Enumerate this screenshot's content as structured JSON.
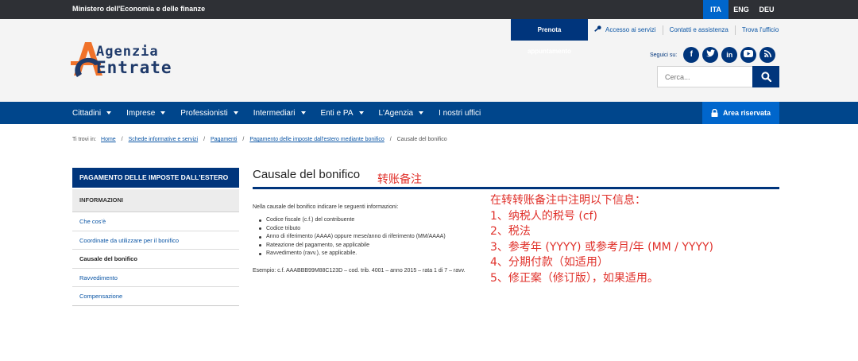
{
  "topbar": {
    "ministry": "Ministero dell'Economia e delle finanze",
    "languages": [
      {
        "label": "ITA",
        "active": true
      },
      {
        "label": "ENG",
        "active": false
      },
      {
        "label": "DEU",
        "active": false
      }
    ]
  },
  "header": {
    "logo": {
      "line1": "Agenzia",
      "line2": "Entrate"
    },
    "links": {
      "prenota": "Prenota appuntamento",
      "accesso": "Accesso ai servizi",
      "contatti": "Contatti e assistenza",
      "ufficio": "Trova l'ufficio"
    },
    "social_label": "Seguici su:",
    "social_icons": [
      "facebook-icon",
      "twitter-icon",
      "linkedin-icon",
      "youtube-icon",
      "rss-icon"
    ],
    "search": {
      "placeholder": "Cerca..."
    }
  },
  "nav": {
    "items": [
      {
        "label": "Cittadini"
      },
      {
        "label": "Imprese"
      },
      {
        "label": "Professionisti"
      },
      {
        "label": "Intermediari"
      },
      {
        "label": "Enti e PA"
      },
      {
        "label": "L'Agenzia"
      },
      {
        "label": "I nostri uffici"
      }
    ],
    "area_riservata": "Area riservata"
  },
  "breadcrumb": {
    "prefix": "Ti trovi in:",
    "items": [
      "Home",
      "Schede informative e servizi",
      "Pagamenti",
      "Pagamento delle imposte dall'estero mediante bonifico"
    ],
    "current": "Causale del bonifico"
  },
  "sidebar": {
    "title": "PAGAMENTO DELLE IMPOSTE DALL'ESTERO",
    "section": "INFORMAZIONI",
    "items": [
      "Che cos'è",
      "Coordinate da utilizzare per il bonifico",
      "Causale del bonifico",
      "Ravvedimento",
      "Compensazione"
    ]
  },
  "main": {
    "title": "Causale del bonifico",
    "title_note": "转账备注",
    "intro": "Nella causale del bonifico indicare le seguenti informazioni:",
    "list": [
      "Codice fiscale (c.f.) del contribuente",
      "Codice tributo",
      "Anno di riferimento (AAAA) oppure mese/anno di riferimento (MM/AAAA)",
      "Rateazione del pagamento, se applicabile",
      "Ravvedimento (ravv.), se applicabile."
    ],
    "example": "Esempio: c.f. AAABBB99M88C123D – cod. trib. 4001 – anno 2015 – rata 1 di 7 – ravv.",
    "annotations": [
      "在转转账备注中注明以下信息：",
      "1、纳税人的税号 (cf)",
      "2、税法",
      "3、参考年 (YYYY) 或参考月/年 (MM / YYYY)",
      "4、分期付款（如适用）",
      "5、修正案（修订版），如果适用。"
    ]
  },
  "colors": {
    "topbar": "#2e3035",
    "header_bg": "#f4f4f4",
    "brand_dark": "#00357c",
    "nav": "#00468c",
    "accent": "#0066cc",
    "link": "#0a55a5",
    "annotation": "#e0312b",
    "logo_orange": "#f0722a"
  }
}
